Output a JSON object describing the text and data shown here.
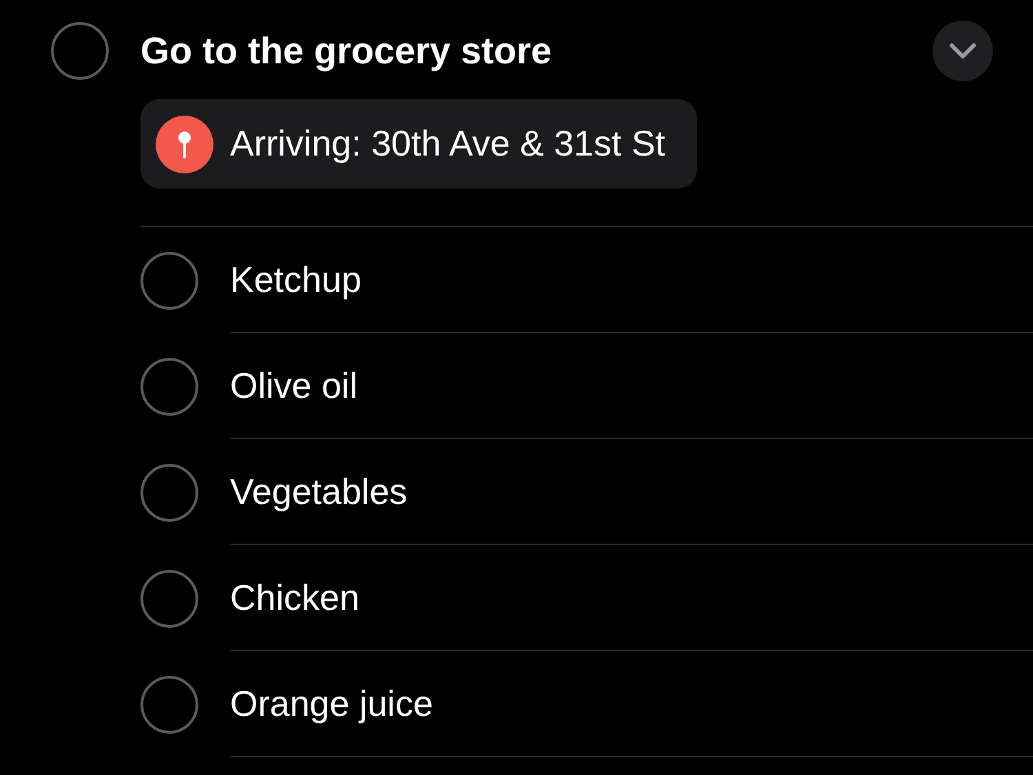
{
  "task": {
    "title": "Go to the grocery store",
    "checked": false,
    "expanded": true,
    "location": {
      "text": "Arriving: 30th Ave & 31st St"
    }
  },
  "subtasks": [
    {
      "title": "Ketchup",
      "checked": false
    },
    {
      "title": "Olive oil",
      "checked": false
    },
    {
      "title": "Vegetables",
      "checked": false
    },
    {
      "title": "Chicken",
      "checked": false
    },
    {
      "title": "Orange juice",
      "checked": false
    }
  ]
}
